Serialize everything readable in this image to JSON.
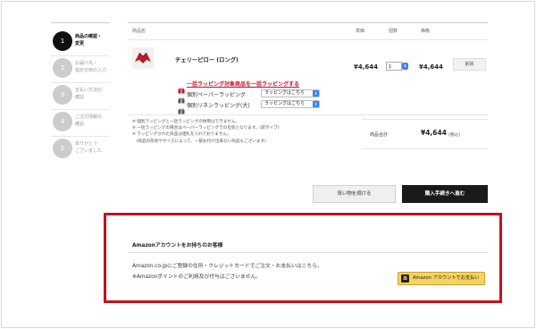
{
  "steps": [
    {
      "num": "1",
      "label": "商品の確認・\n変更",
      "active": true
    },
    {
      "num": "2",
      "label": "お届け先・\n指定日時の入力",
      "active": false
    },
    {
      "num": "3",
      "label": "支払い方法の\n確認",
      "active": false
    },
    {
      "num": "4",
      "label": "ご注文情報の\n確認",
      "active": false
    },
    {
      "num": "5",
      "label": "ありがとう\nございました",
      "active": false
    }
  ],
  "table": {
    "col_product": "商品名",
    "col_unit_price": "単価",
    "col_qty": "個数",
    "col_price": "価格"
  },
  "item": {
    "name": "チェリーピロー (ロング)",
    "unit_price": "¥4,644",
    "qty": "1",
    "price": "¥4,644",
    "delete_label": "削除",
    "wrap_all_link": "一括ラッピング対象商品を一括ラッピングする",
    "wrap_paper_label": "個別ペーパーラッピング",
    "wrap_linen_label": "個別リネンラッピング(大)",
    "wrap_select_label": "ラッピングはこちら"
  },
  "notes": "※ 個別ラッピングと一括ラッピングの併用はできません。\n※ 一括ラッピングの場合はペーパーラッピングでの包装となります。(袋タイプ)\n※ ラッピングされた商品は値札を入れておりません。\n　(商品の形状やサイズによって、一部お付け出来ない商品もございます)",
  "summary": {
    "label": "商品合計",
    "total": "¥4,644",
    "tax": "(税込)"
  },
  "buttons": {
    "continue": "買い物を続ける",
    "checkout": "購入手続きへ進む"
  },
  "amazon": {
    "title": "Amazonアカウントをお持ちのお客様",
    "desc": "Amazon.co.jpにご登録の住所・クレジットカードでご注文・お支払いはこちら。\n※Amazonポイントのご利用及び付与はございません。",
    "pay_button": "Amazon アカウントでお支払い",
    "logo_letter": "a"
  },
  "colors": {
    "accent_red": "#c1121f",
    "select_blue": "#3b86e6",
    "amazon_yellow": "#f4d35e"
  }
}
